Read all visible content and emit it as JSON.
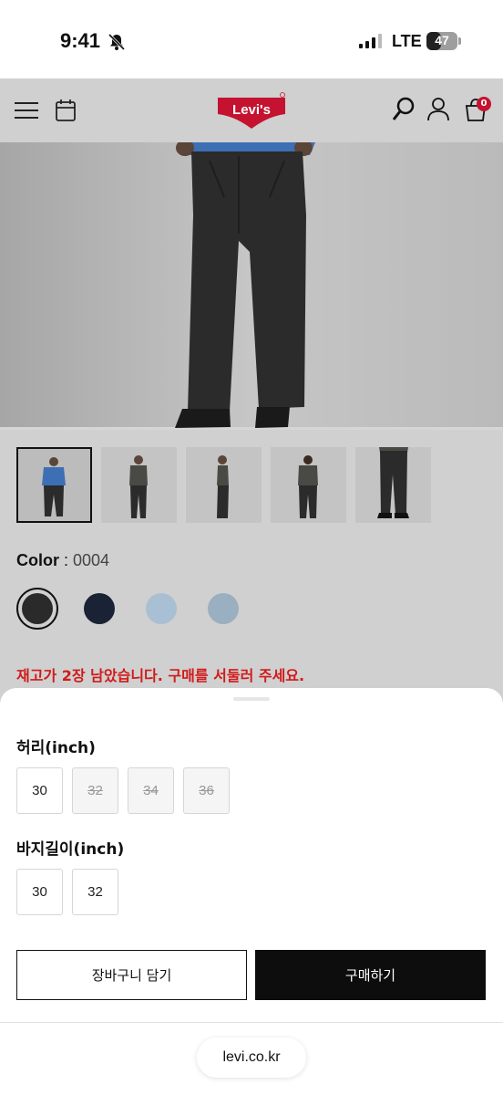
{
  "status_bar": {
    "time": "9:41",
    "network": "LTE",
    "battery": "47"
  },
  "header": {
    "logo_text": "Levi's",
    "cart_count": "0"
  },
  "product": {
    "color_label": "Color",
    "color_separator": " : ",
    "color_value": "0004",
    "swatches": [
      {
        "name": "black",
        "color": "#2a2a2a",
        "selected": true
      },
      {
        "name": "navy",
        "color": "#1a2235"
      },
      {
        "name": "light-blue",
        "color": "#a9bfd3"
      },
      {
        "name": "mid-blue",
        "color": "#9aafc0"
      }
    ],
    "stock_warning": "재고가 2장 남았습니다. 구매를 서둘러 주세요."
  },
  "options": {
    "waist_label": "허리(inch)",
    "waist_sizes": [
      {
        "label": "30",
        "available": true
      },
      {
        "label": "32",
        "available": false
      },
      {
        "label": "34",
        "available": false
      },
      {
        "label": "36",
        "available": false
      }
    ],
    "length_label": "바지길이(inch)",
    "length_sizes": [
      {
        "label": "30",
        "available": true
      },
      {
        "label": "32",
        "available": true
      }
    ]
  },
  "actions": {
    "add_to_cart": "장바구니 담기",
    "buy_now": "구매하기"
  },
  "browser": {
    "url": "levi.co.kr"
  },
  "colors": {
    "accent_red": "#d11a1a",
    "brand_red": "#c41230",
    "buy_button": "#0d0d0d"
  }
}
